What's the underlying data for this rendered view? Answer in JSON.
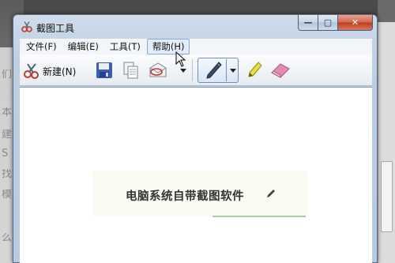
{
  "window": {
    "title": "截图工具",
    "controls": {
      "minimize": "—",
      "maximize": "▢",
      "close": "✕"
    }
  },
  "menu": [
    {
      "label": "文件(F)"
    },
    {
      "label": "编辑(E)"
    },
    {
      "label": "工具(T)"
    },
    {
      "label": "帮助(H)"
    }
  ],
  "toolbar": {
    "new_label": "新建(N)",
    "icons": [
      "snip-scissors-icon",
      "save-icon",
      "copy-icon",
      "send-snip-icon",
      "pen-icon",
      "highlighter-icon",
      "eraser-icon"
    ]
  },
  "canvas": {
    "snip_text": "电脑系统自带截图软件"
  },
  "colors": {
    "frame": "#bccfe3",
    "close": "#c84a2d",
    "highlighter": "#e6e23a",
    "eraser": "#e58ab2"
  }
}
